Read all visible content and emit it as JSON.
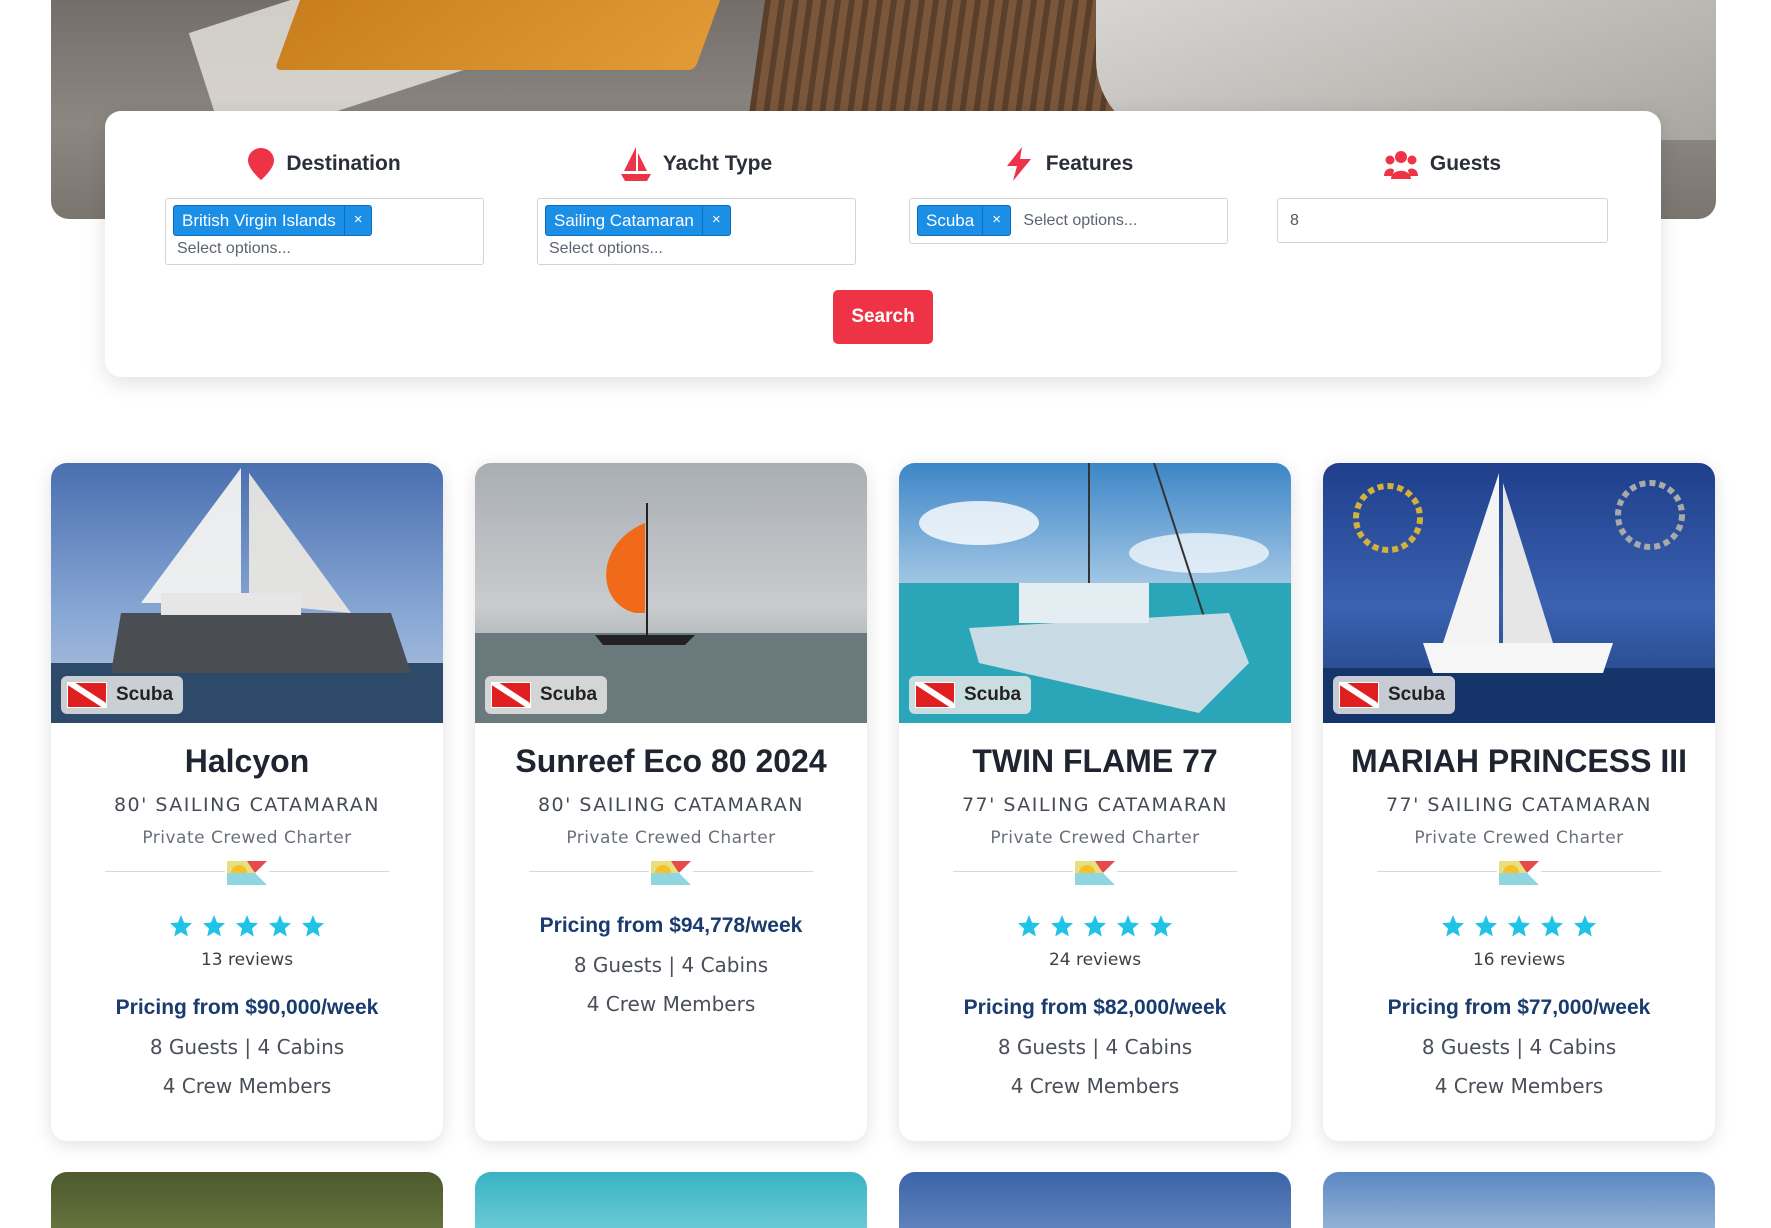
{
  "search": {
    "destination": {
      "label": "Destination",
      "chip": "British Virgin Islands",
      "chip_remove": "×",
      "placeholder": "Select options..."
    },
    "yacht_type": {
      "label": "Yacht Type",
      "chip": "Sailing Catamaran",
      "chip_remove": "×",
      "placeholder": "Select options..."
    },
    "features": {
      "label": "Features",
      "chip": "Scuba",
      "chip_remove": "×",
      "placeholder": "Select options..."
    },
    "guests": {
      "label": "Guests",
      "value": "8"
    },
    "button": "Search",
    "accent_color": "#ef3346",
    "chip_color": "#1b8ee6"
  },
  "cards": [
    {
      "badge": "Scuba",
      "name": "Halcyon",
      "type": "80' SAILING CATAMARAN",
      "charter": "Private Crewed Charter",
      "rating": 5,
      "reviews": "13 reviews",
      "price": "Pricing from $90,000/week",
      "guests_cabins": "8 Guests | 4 Cabins",
      "crew": "4 Crew Members"
    },
    {
      "badge": "Scuba",
      "name": "Sunreef Eco 80 2024",
      "type": "80' SAILING CATAMARAN",
      "charter": "Private Crewed Charter",
      "rating": 0,
      "reviews": "",
      "price": "Pricing from $94,778/week",
      "guests_cabins": "8 Guests | 4 Cabins",
      "crew": "4 Crew Members"
    },
    {
      "badge": "Scuba",
      "name": "TWIN FLAME 77",
      "type": "77' SAILING CATAMARAN",
      "charter": "Private Crewed Charter",
      "rating": 5,
      "reviews": "24 reviews",
      "price": "Pricing from $82,000/week",
      "guests_cabins": "8 Guests | 4 Cabins",
      "crew": "4 Crew Members"
    },
    {
      "badge": "Scuba",
      "name": "MARIAH PRINCESS III",
      "type": "77' SAILING CATAMARAN",
      "charter": "Private Crewed Charter",
      "rating": 5,
      "reviews": "16 reviews",
      "price": "Pricing from $77,000/week",
      "guests_cabins": "8 Guests | 4 Cabins",
      "crew": "4 Crew Members"
    }
  ],
  "colors": {
    "star": "#1fc3e6",
    "price": "#1a3b6e"
  },
  "icons": {
    "destination": "map-pin-icon",
    "yacht_type": "sailboat-icon",
    "features": "lightning-icon",
    "guests": "users-icon",
    "badge": "dive-flag-icon",
    "divider_logo": "company-logo"
  }
}
